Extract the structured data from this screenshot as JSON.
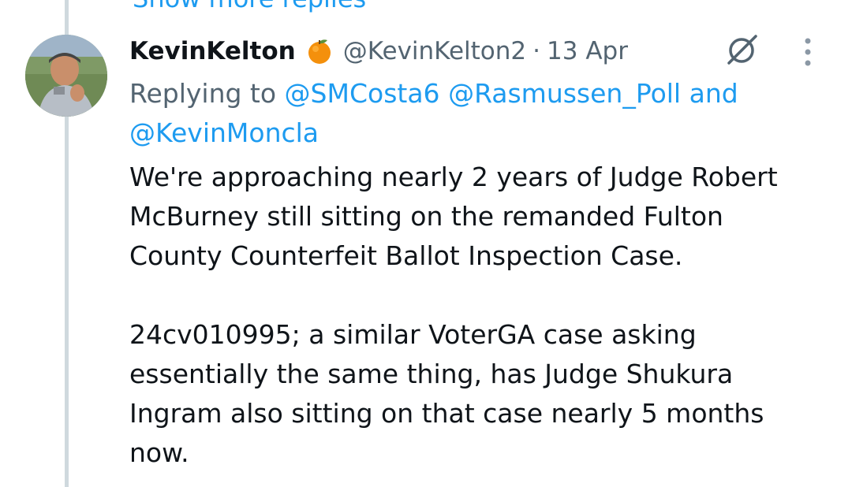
{
  "thread": {
    "show_more_label": "Show more replies"
  },
  "tweet": {
    "display_name": "KevinKelton",
    "badge_icon": "orange-fruit-icon",
    "handle": "@KevinKelton2",
    "separator": "·",
    "time": "13 Apr",
    "replying_prefix": "Replying to",
    "mentions": [
      "@SMCosta6",
      "@Rasmussen_Poll",
      "@KevinMoncla"
    ],
    "replying_and": "and",
    "paragraphs": [
      "We're approaching nearly 2 years of Judge Robert McBurney still sitting on the remanded Fulton County Counterfeit Ballot Inspection Case.",
      "24cv010995; a similar VoterGA case asking essentially the same thing, has Judge Shukura Ingram also sitting on that case nearly 5 months now."
    ]
  },
  "icons": {
    "grok": "grok-icon",
    "more": "more-vertical-icon"
  },
  "colors": {
    "link": "#1d9bf0",
    "secondary_text": "#536471",
    "primary_text": "#0f1419",
    "thread_line": "#cfd9de"
  }
}
